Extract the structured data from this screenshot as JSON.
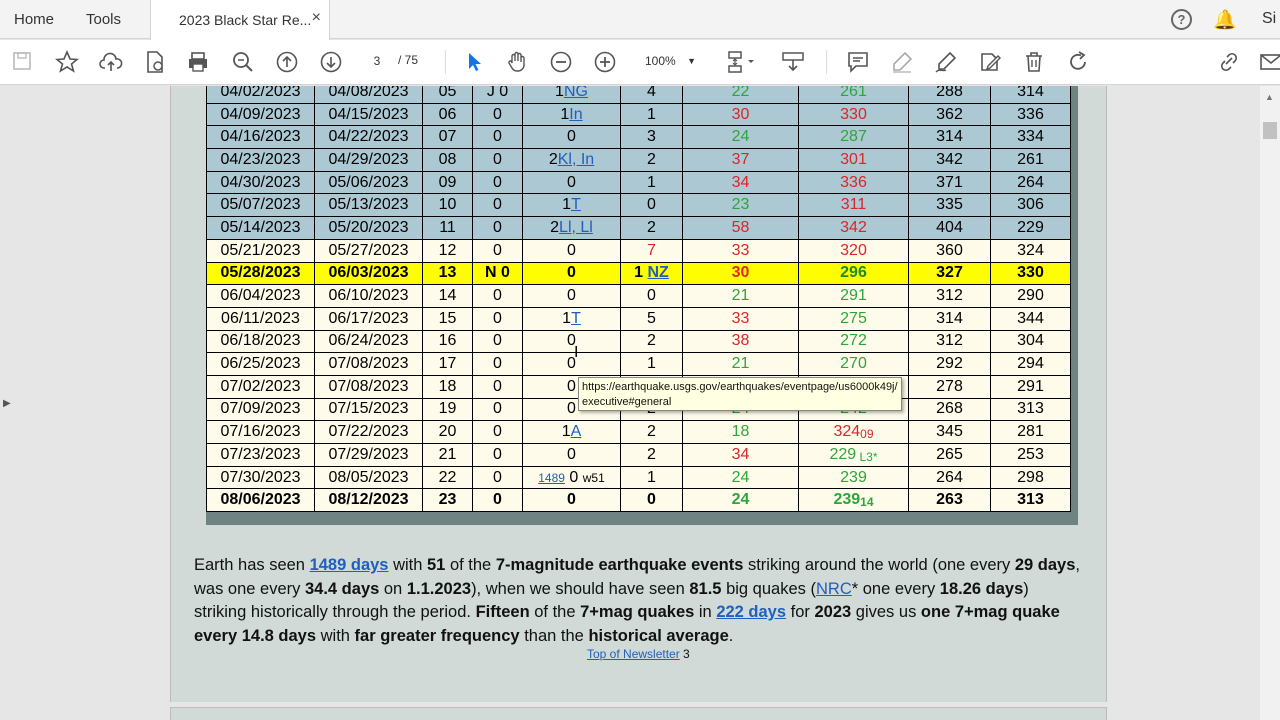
{
  "tabs": {
    "home": "Home",
    "tools": "Tools",
    "document": "2023 Black Star Re...",
    "close": "×",
    "signin": "Si"
  },
  "toolbar": {
    "page_current": "3",
    "page_total": "/ 75",
    "zoom": "100%"
  },
  "table": {
    "rows": [
      {
        "style": "hi",
        "cells": [
          "04/02/2023",
          "04/08/2023",
          "05",
          "J 0",
          "1NG",
          "4",
          "22",
          "261",
          "288",
          "314"
        ]
      },
      {
        "style": "hi",
        "cells": [
          "04/09/2023",
          "04/15/2023",
          "06",
          "0",
          "1In",
          "1",
          "30",
          "330",
          "362",
          "336"
        ]
      },
      {
        "style": "hi",
        "cells": [
          "04/16/2023",
          "04/22/2023",
          "07",
          "0",
          "0",
          "3",
          "24",
          "287",
          "314",
          "334"
        ]
      },
      {
        "style": "hi",
        "cells": [
          "04/23/2023",
          "04/29/2023",
          "08",
          "0",
          "2Kl, In",
          "2",
          "37",
          "301",
          "342",
          "261"
        ]
      },
      {
        "style": "hi",
        "cells": [
          "04/30/2023",
          "05/06/2023",
          "09",
          "0",
          "0",
          "1",
          "34",
          "336",
          "371",
          "264"
        ]
      },
      {
        "style": "hi",
        "cells": [
          "05/07/2023",
          "05/13/2023",
          "10",
          "0",
          "1T",
          "0",
          "23",
          "311",
          "335",
          "306"
        ]
      },
      {
        "style": "hi",
        "cells": [
          "05/14/2023",
          "05/20/2023",
          "11",
          "0",
          "2Ll, Ll",
          "2",
          "58",
          "342",
          "404",
          "229"
        ]
      },
      {
        "style": "",
        "cells": [
          "05/21/2023",
          "05/27/2023",
          "12",
          "0",
          "0",
          "7",
          "33",
          "320",
          "360",
          "324"
        ]
      },
      {
        "style": "yel",
        "cells": [
          "05/28/2023",
          "06/03/2023",
          "13",
          "N 0",
          "0",
          "1 NZ",
          "30",
          "296",
          "327",
          "330"
        ]
      },
      {
        "style": "",
        "cells": [
          "06/04/2023",
          "06/10/2023",
          "14",
          "0",
          "0",
          "0",
          "21",
          "291",
          "312",
          "290"
        ]
      },
      {
        "style": "",
        "cells": [
          "06/11/2023",
          "06/17/2023",
          "15",
          "0",
          "1T",
          "5",
          "33",
          "275",
          "314",
          "344"
        ]
      },
      {
        "style": "",
        "cells": [
          "06/18/2023",
          "06/24/2023",
          "16",
          "0",
          "0",
          "2",
          "38",
          "272",
          "312",
          "304"
        ]
      },
      {
        "style": "",
        "cells": [
          "06/25/2023",
          "07/08/2023",
          "17",
          "0",
          "0",
          "1",
          "21",
          "270",
          "292",
          "294"
        ]
      },
      {
        "style": "",
        "cells": [
          "07/02/2023",
          "07/08/2023",
          "18",
          "0",
          "0",
          "",
          "",
          "",
          "278",
          "291"
        ]
      },
      {
        "style": "",
        "cells": [
          "07/09/2023",
          "07/15/2023",
          "19",
          "0",
          "0",
          "2",
          "24",
          "242",
          "268",
          "313"
        ]
      },
      {
        "style": "",
        "cells": [
          "07/16/2023",
          "07/22/2023",
          "20",
          "0",
          "1A",
          "2",
          "18",
          "324",
          "345",
          "281"
        ]
      },
      {
        "style": "",
        "cells": [
          "07/23/2023",
          "07/29/2023",
          "21",
          "0",
          "0",
          "2",
          "34",
          "229",
          "265",
          "253"
        ]
      },
      {
        "style": "",
        "cells": [
          "07/30/2023",
          "08/05/2023",
          "22",
          "0",
          "0",
          "1",
          "24",
          "239",
          "264",
          "298"
        ]
      },
      {
        "style": "b",
        "cells": [
          "08/06/2023",
          "08/12/2023",
          "23",
          "0",
          "0",
          "0",
          "24",
          "239",
          "263",
          "313"
        ]
      }
    ],
    "extras": {
      "sub_09": "09",
      "sub_L3": "L3*",
      "days_1489": "1489",
      "w51": "w51",
      "sub_14": "14"
    }
  },
  "paragraph": {
    "p1": "Earth has seen ",
    "l1": "1489 days",
    "p2": " with ",
    "b1": "51",
    "p3": " of the ",
    "b2": "7-magnitude earthquake events",
    "p4": " striking around the world (one every ",
    "b3": "29 days",
    "p5": ", was one every ",
    "b4": "34.4 days",
    "p6": " on ",
    "b5": "1.1.2023",
    "p7": "), when we should have seen ",
    "b6": "81.5",
    "p8": " big quakes (",
    "l2": "NRC",
    "p9": "* one every ",
    "b7": "18.26 days",
    "p10": ") striking historically through the period. ",
    "b8": "Fifteen",
    "p11": " of the ",
    "b9": "7+mag quakes",
    "p12": " in ",
    "l3": "222 days",
    "p13": " for ",
    "b10": "2023",
    "p14": " gives us ",
    "b11": "one 7+mag quake every 14.8 days",
    "p15": " with ",
    "b12": "far greater frequency",
    "p16": " than the ",
    "b13": "historical average",
    "p17": "."
  },
  "footer_link": {
    "text": "Top of Newsletter",
    "page": " 3"
  },
  "tooltip": "https://earthquake.usgs.gov/earthquakes/eventpage/us6000k49j/executive#general"
}
